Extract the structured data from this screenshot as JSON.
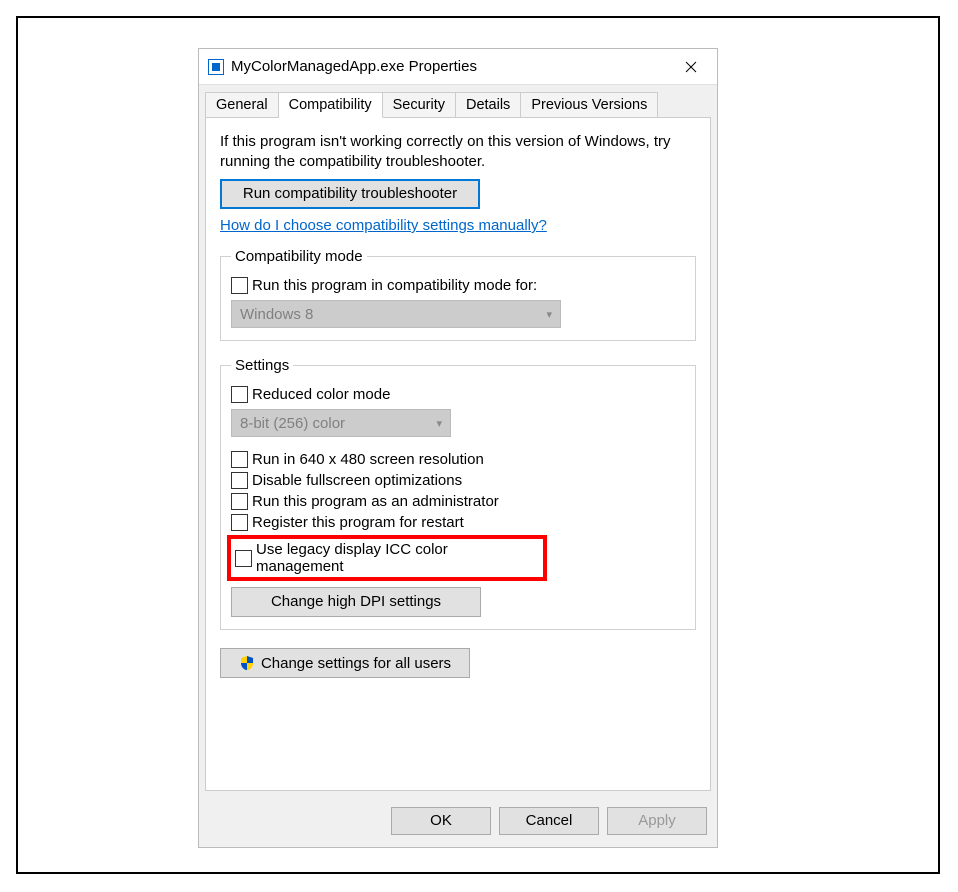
{
  "window": {
    "title": "MyColorManagedApp.exe Properties"
  },
  "tabs": {
    "general": "General",
    "compatibility": "Compatibility",
    "security": "Security",
    "details": "Details",
    "previous": "Previous Versions",
    "active": "compatibility"
  },
  "intro": "If this program isn't working correctly on this version of Windows, try running the compatibility troubleshooter.",
  "troubleshooter_button": "Run compatibility troubleshooter",
  "help_link": "How do I choose compatibility settings manually?",
  "compat_mode": {
    "legend": "Compatibility mode",
    "checkbox": "Run this program in compatibility mode for:",
    "combo_value": "Windows 8"
  },
  "settings": {
    "legend": "Settings",
    "reduced_color": "Reduced color mode",
    "color_combo": "8-bit (256) color",
    "run_640": "Run in 640 x 480 screen resolution",
    "disable_fullscreen": "Disable fullscreen optimizations",
    "run_admin": "Run this program as an administrator",
    "register_restart": "Register this program for restart",
    "legacy_icc": "Use legacy display ICC color management",
    "dpi_button": "Change high DPI settings"
  },
  "all_users_button": "Change settings for all users",
  "dialog_buttons": {
    "ok": "OK",
    "cancel": "Cancel",
    "apply": "Apply"
  }
}
